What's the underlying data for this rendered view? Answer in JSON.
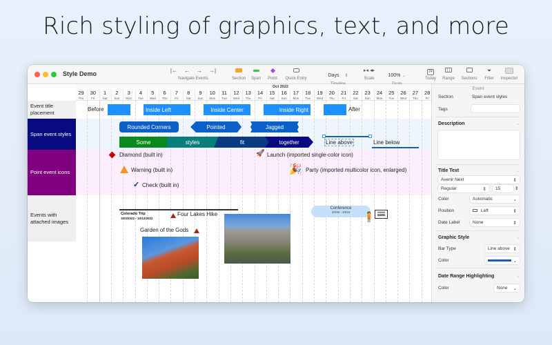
{
  "headline": "Rich styling of graphics, text, and more",
  "window": {
    "title": "Style Demo"
  },
  "toolbar": {
    "navigate": {
      "label": "Navigate Events",
      "icons": [
        "first-icon",
        "prev-icon",
        "next-icon",
        "last-icon"
      ],
      "glyphs": [
        "|←",
        "←",
        "→",
        "→|"
      ]
    },
    "section": {
      "label": "Section",
      "color": "#f5a623"
    },
    "span": {
      "label": "Span",
      "color": "#2ecc40"
    },
    "point": {
      "label": "Point",
      "color": "#b044e0"
    },
    "quick_entry": {
      "label": "Quick Entry"
    },
    "timeline": {
      "label": "Timeline",
      "value": "Days"
    },
    "scale": {
      "label": "Scale"
    },
    "zoom": {
      "label": "Zoom",
      "value": "100%"
    },
    "today": {
      "label": "Today",
      "glyph": "24"
    },
    "range": {
      "label": "Range"
    },
    "sections": {
      "label": "Sections"
    },
    "filter": {
      "label": "Filter"
    },
    "inspector": {
      "label": "Inspector"
    }
  },
  "ruler": {
    "month": "Oct 2022",
    "days": [
      {
        "n": "29",
        "w": "Thu"
      },
      {
        "n": "30",
        "w": "Fri"
      },
      {
        "n": "1",
        "w": "Sat"
      },
      {
        "n": "2",
        "w": "Sun"
      },
      {
        "n": "3",
        "w": "Mon"
      },
      {
        "n": "4",
        "w": "Tue"
      },
      {
        "n": "5",
        "w": "Wed"
      },
      {
        "n": "6",
        "w": "Thu"
      },
      {
        "n": "7",
        "w": "Fri"
      },
      {
        "n": "8",
        "w": "Sat"
      },
      {
        "n": "9",
        "w": "Sun"
      },
      {
        "n": "10",
        "w": "Mon"
      },
      {
        "n": "11",
        "w": "Tue"
      },
      {
        "n": "12",
        "w": "Wed"
      },
      {
        "n": "13",
        "w": "Thu"
      },
      {
        "n": "14",
        "w": "Fri"
      },
      {
        "n": "15",
        "w": "Sat"
      },
      {
        "n": "16",
        "w": "Sun"
      },
      {
        "n": "17",
        "w": "Mon"
      },
      {
        "n": "18",
        "w": "Tue"
      },
      {
        "n": "19",
        "w": "Wed"
      },
      {
        "n": "20",
        "w": "Thu"
      },
      {
        "n": "21",
        "w": "Fri"
      },
      {
        "n": "22",
        "w": "Sat"
      },
      {
        "n": "23",
        "w": "Sun"
      },
      {
        "n": "24",
        "w": "Mon"
      },
      {
        "n": "25",
        "w": "Tue"
      },
      {
        "n": "26",
        "w": "Wed"
      },
      {
        "n": "27",
        "w": "Thu"
      },
      {
        "n": "28",
        "w": "Fri"
      }
    ]
  },
  "sections": [
    {
      "label": "Event title placement",
      "bg": "#f0f0f0",
      "fg": "#222",
      "band": "#ffffff"
    },
    {
      "label": "Span event styles",
      "bg": "#0a0a80",
      "fg": "#ffffff",
      "band": "#eef5fd"
    },
    {
      "label": "Point event icons",
      "bg": "#800080",
      "fg": "#ffffff",
      "band": "#fdeefd"
    },
    {
      "label": "Events with attached images",
      "bg": "#efefef",
      "fg": "#222",
      "band": "#ffffff"
    }
  ],
  "events": {
    "placement": {
      "before": "Before",
      "inside_left": "Inside Left",
      "inside_center": "Inside Center",
      "inside_right": "Inside Right",
      "after": "After",
      "color": "#1e90ff"
    },
    "spans": {
      "rounded": "Rounded Corners",
      "pointed": "Pointed",
      "jagged": "Jagged",
      "some": "Some",
      "styles": "styles",
      "fit": "fit",
      "together": "together",
      "line_above": "Line above",
      "line_below": "Line below",
      "colors": {
        "blue": "#0a60c8",
        "green": "#0a8a1e",
        "teal": "#0a7e7a",
        "navy": "#0a3a80",
        "darknavy": "#0a0a80",
        "line": "#1a5fb4"
      }
    },
    "points": {
      "diamond": "Diamond (built in)",
      "warning": "Warning (built in)",
      "check": "Check (built in)",
      "launch": "Launch (imported single-color icon)",
      "party": "Party (imported multicolor icon, enlarged)"
    },
    "images": {
      "trip_title": "Colorado Trip",
      "trip_dates": "10/3/2022 - 10/12/2022",
      "hike": "Four Lakes Hike",
      "garden": "Garden of the Gods",
      "conference_title": "Conference",
      "conference_dates": "10/19 - 10/23"
    }
  },
  "inspector": {
    "tab": "Event",
    "section_label": "Section",
    "section_value": "Span event styles",
    "tags_label": "Tags",
    "tags_value": "",
    "description_head": "Description",
    "description_value": "",
    "title_text_head": "Title Text",
    "font": "Avenir Next",
    "weight": "Regular",
    "size": "15",
    "color_label": "Color",
    "color_value": "Automatic",
    "position_label": "Position",
    "position_value": "Left",
    "date_label_label": "Date Label",
    "date_label_value": "None",
    "graphic_style_head": "Graphic Style",
    "bar_type_label": "Bar Type",
    "bar_type_value": "Line above",
    "graphic_color_label": "Color",
    "graphic_color": "#1a5fb4",
    "date_range_head": "Date Range Highlighting",
    "range_color_label": "Color",
    "range_color_value": "None"
  }
}
